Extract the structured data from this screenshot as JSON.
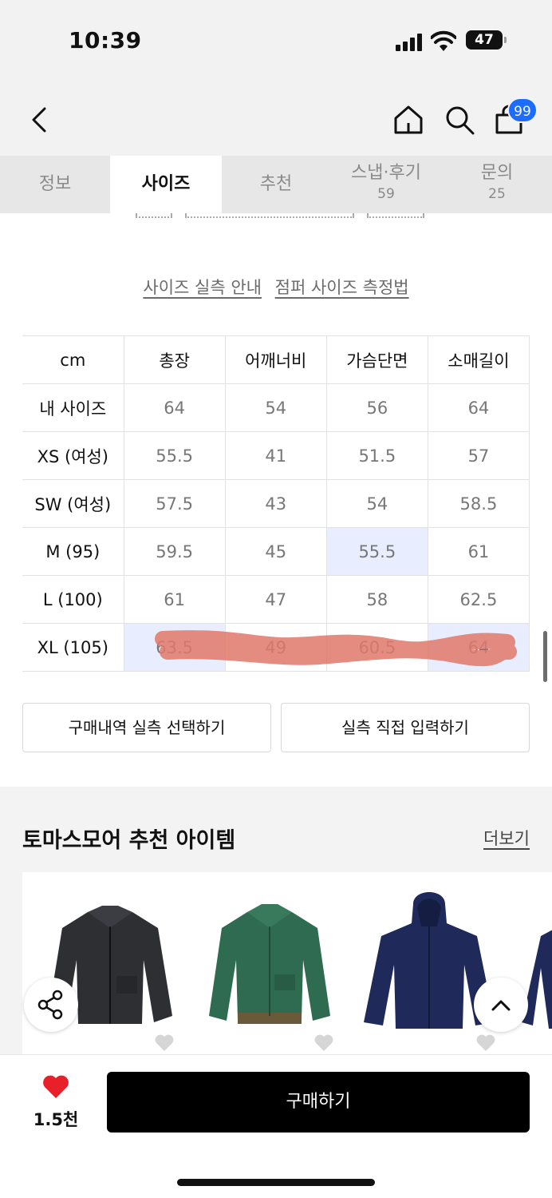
{
  "status": {
    "time": "10:39",
    "battery": "47"
  },
  "header": {
    "cart_count": "99"
  },
  "tabs": [
    {
      "label": "정보",
      "count": ""
    },
    {
      "label": "사이즈",
      "count": ""
    },
    {
      "label": "추천",
      "count": ""
    },
    {
      "label": "스냅·후기",
      "count": "59"
    },
    {
      "label": "문의",
      "count": "25"
    }
  ],
  "guide": {
    "link1": "사이즈 실측 안내",
    "link2": "점퍼 사이즈 측정법"
  },
  "size_table": {
    "headers": [
      "cm",
      "총장",
      "어깨너비",
      "가슴단면",
      "소매길이"
    ],
    "rows": [
      {
        "label": "내 사이즈",
        "values": [
          "64",
          "54",
          "56",
          "64"
        ]
      },
      {
        "label": "XS (여성)",
        "values": [
          "55.5",
          "41",
          "51.5",
          "57"
        ]
      },
      {
        "label": "SW (여성)",
        "values": [
          "57.5",
          "43",
          "54",
          "58.5"
        ]
      },
      {
        "label": "M (95)",
        "values": [
          "59.5",
          "45",
          "55.5",
          "61"
        ]
      },
      {
        "label": "L (100)",
        "values": [
          "61",
          "47",
          "58",
          "62.5"
        ]
      },
      {
        "label": "XL (105)",
        "values": [
          "63.5",
          "49",
          "60.5",
          "64"
        ]
      }
    ]
  },
  "buttons": {
    "purchase_history": "구매내역 실측 선택하기",
    "direct_input": "실측 직접 입력하기"
  },
  "recommend": {
    "title": "토마스모어 추천 아이템",
    "more": "더보기"
  },
  "bottom": {
    "likes": "1.5천",
    "buy": "구매하기"
  },
  "colors": {
    "accent": "#1b6cff",
    "highlight": "#e8eeff",
    "like": "#e8202a",
    "buy": "#000000"
  }
}
